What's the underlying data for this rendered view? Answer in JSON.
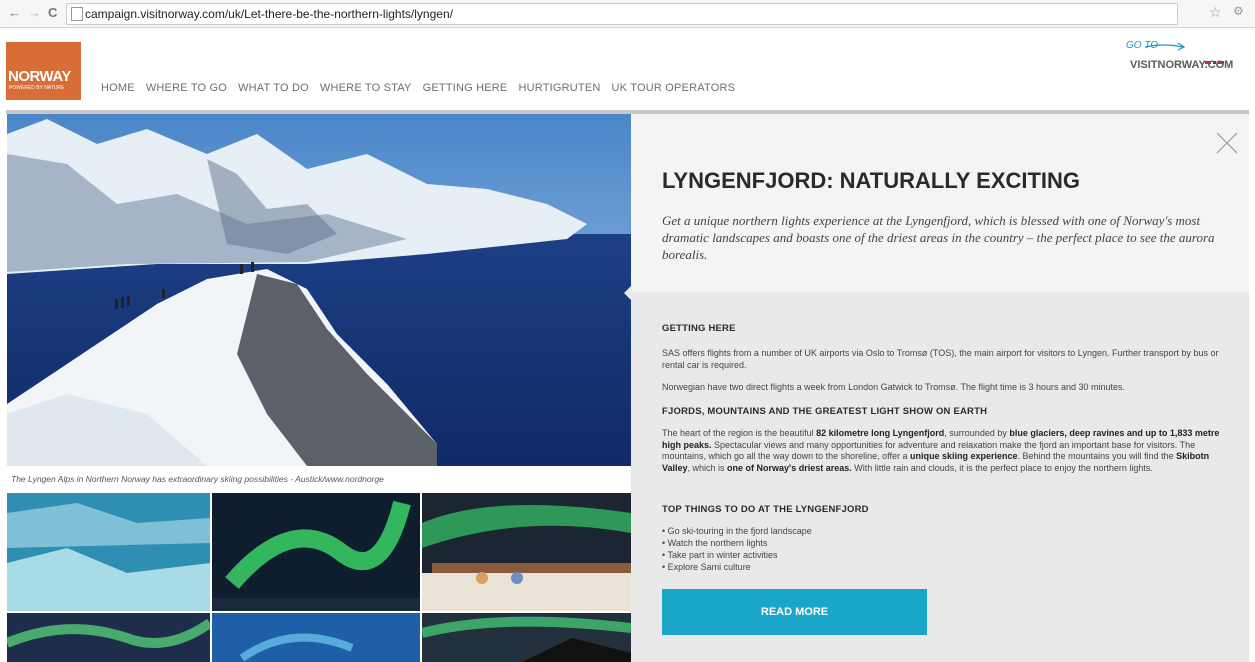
{
  "browser": {
    "back": "←",
    "forward": "→",
    "reload": "C",
    "url": "campaign.visitnorway.com/uk/Let-there-be-the-northern-lights/lyngen/"
  },
  "logo": {
    "name": "NORWAY",
    "tagline": "POWERED BY NATURE"
  },
  "nav": [
    "HOME",
    "WHERE TO GO",
    "WHAT TO DO",
    "WHERE TO STAY",
    "GETTING HERE",
    "HURTIGRUTEN",
    "UK TOUR OPERATORS"
  ],
  "visitnorway": {
    "goto": "GO TO",
    "site": "VISITNORWAY.COM"
  },
  "hero": {
    "caption": "The Lyngen Alps in Northern Norway has extraordinary skiing possibilities - Austick/www.nordnorge"
  },
  "article": {
    "title": "LYNGENFJORD: NATURALLY EXCITING",
    "lead": "Get a unique northern lights experience at the Lyngenfjord, which is blessed with one of Norway's most dramatic landscapes and boasts one of the driest areas in the country – the perfect place to see the aurora borealis.",
    "getting_here_heading": "GETTING HERE",
    "getting_here_p1": "SAS offers flights from a number of UK airports via Oslo to Tromsø (TOS), the main airport for visitors to Lyngen. Further transport by bus or rental car is required.",
    "getting_here_p2": "Norwegian have two direct flights a week from London Gatwick to Tromsø. The flight time is 3 hours and 30 minutes.",
    "fjords_heading": "FJORDS, MOUNTAINS AND THE GREATEST LIGHT SHOW ON EARTH",
    "fjords_p": {
      "t1": "The heart of the region is the beautiful ",
      "b1": "82 kilometre long Lyngenfjord",
      "t2": ", surrounded by ",
      "b2": "blue glaciers, deep ravines and up to 1,833 metre high peaks.",
      "t3": " Spectacular views and many opportunities for adventure and relaxation make the fjord an important base for visitors. The mountains, which go all the way down to the shoreline, offer a ",
      "b3": "unique skiing experience",
      "t4": ". Behind the mountains you will find the ",
      "b4": "Skibotn Valley",
      "t5": ", which is ",
      "b5": "one of Norway's driest areas.",
      "t6": " With little rain and clouds, it is the perfect place to enjoy the northern lights."
    },
    "todo_heading": "TOP THINGS TO DO AT THE LYNGENFJORD",
    "todo": [
      "Go ski-touring in the fjord landscape",
      "Watch the northern lights",
      "Take part in winter activities",
      "Explore Sami culture"
    ],
    "read_more": "READ MORE"
  },
  "colors": {
    "accent": "#1aa6c8",
    "logo": "#d96d38"
  }
}
